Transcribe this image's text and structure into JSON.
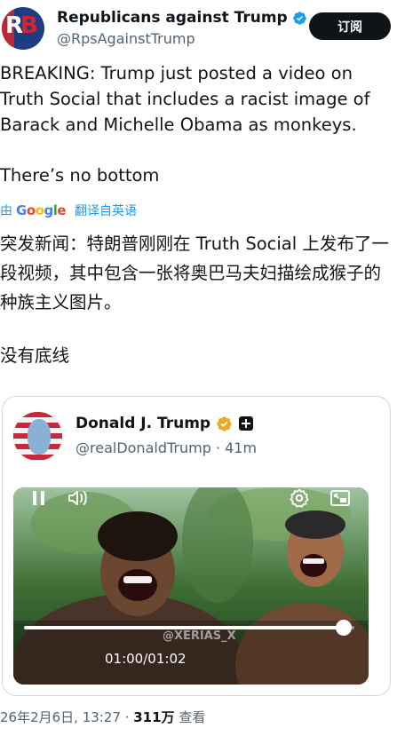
{
  "author": {
    "name": "Republicans against Trump",
    "handle": "@RpsAgainstTrump",
    "avatar_text": "RB"
  },
  "follow_button": "订阅",
  "tweet": {
    "text_en": "BREAKING: Trump just posted a video on Truth Social that includes a racist image of Barack and Michelle Obama as monkeys.",
    "text_en_2": "There’s no bottom",
    "translate_by": "由",
    "translate_brand": "Google",
    "translate_action": "翻译自英语",
    "text_zh": "突发新闻：特朗普刚刚在 Truth Social 上发布了一段视频，其中包含一张将奥巴马夫妇描绘成猴子的种族主义图片。",
    "text_zh_2": "没有底线"
  },
  "quoted": {
    "name": "Donald J. Trump",
    "handle_time": "@realDonaldTrump · 41m",
    "video": {
      "watermark": "@XERIAS_X",
      "current_time": "01:00",
      "separator": "/",
      "total_time": "01:02",
      "progress": 0.968
    }
  },
  "footer": {
    "date": "26年2月6日, 13:27 · ",
    "views": "311万",
    "views_label": " 查看"
  },
  "colors": {
    "verified_blue": "#1d9bf0",
    "link_blue": "#1d9bf0",
    "verified_gold": "#e8aa2c",
    "text_secondary": "#536471",
    "button_dark": "#0f1419"
  },
  "icons": [
    "verified-badge-icon",
    "gold-badge-icon",
    "plus-badge-icon",
    "pause-icon",
    "volume-icon",
    "settings-icon",
    "pip-icon"
  ]
}
